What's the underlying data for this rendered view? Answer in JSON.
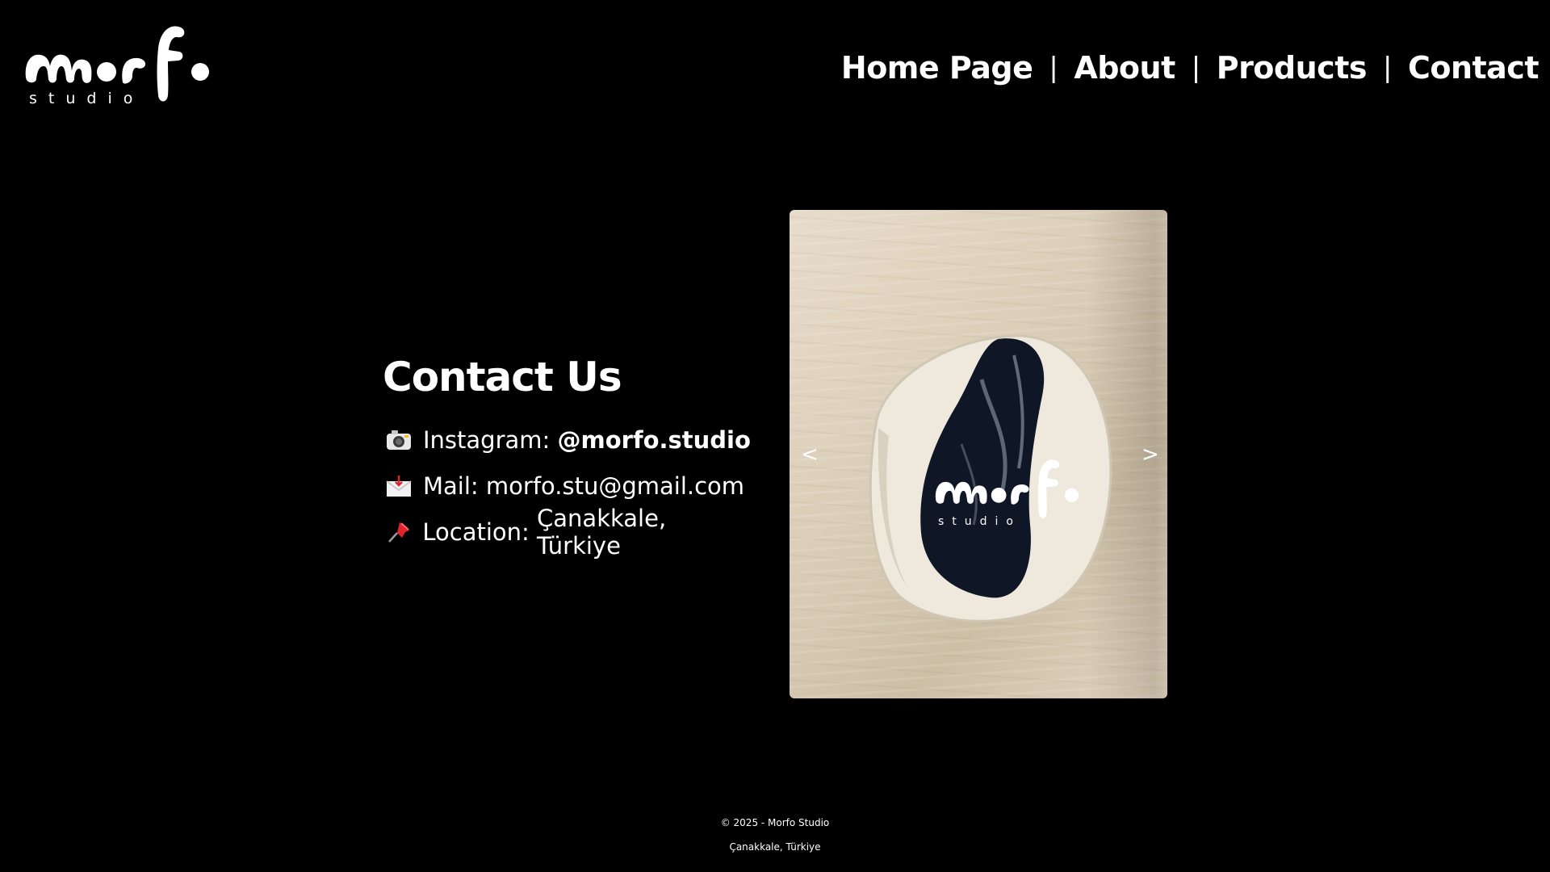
{
  "brand": {
    "logo_word": "morfo",
    "logo_sub": "studio"
  },
  "nav": {
    "items": [
      {
        "label": "Home Page"
      },
      {
        "label": "About"
      },
      {
        "label": "Products"
      },
      {
        "label": "Contact"
      }
    ],
    "separator": "|"
  },
  "contact": {
    "title": "Contact Us",
    "instagram": {
      "icon": "camera-icon",
      "label": "Instagram:",
      "handle": "@morfo.studio"
    },
    "mail": {
      "icon": "envelope-icon",
      "label": "Mail:",
      "value": "morfo.stu@gmail.com"
    },
    "location": {
      "icon": "pushpin-icon",
      "label": "Location:",
      "value": "Çanakkale, Türkiye"
    }
  },
  "carousel": {
    "prev_label": "<",
    "next_label": ">",
    "watermark_word": "morfo",
    "watermark_sub": "studio"
  },
  "footer": {
    "copyright": "© 2025 - Morfo Studio",
    "location": "Çanakkale, Türkiye"
  },
  "colors": {
    "background": "#000000",
    "text": "#ffffff",
    "stone": "#ddd1bd",
    "glaze_dark": "#0f1626"
  }
}
